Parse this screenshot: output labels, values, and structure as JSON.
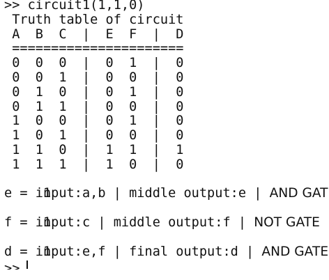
{
  "console": {
    "command": ">> circuit1(1,1,0)",
    "title": " Truth table of circuit",
    "header": " A  B  C  |  E  F  |  D",
    "separator": " ======================",
    "rows": [
      " 0  0  0  |  0  1  |  0",
      " 0  0  1  |  0  0  |  0",
      " 0  1  0  |  0  1  |  0",
      " 0  1  1  |  0  0  |  0",
      " 1  0  0  |  0  1  |  0",
      " 1  0  1  |  0  0  |  0",
      " 1  1  0  |  1  1  |  1",
      " 1  1  1  |  1  0  |  0"
    ],
    "gate1": {
      "label_a": "input:a,b | middle output:e | ",
      "label_b": "AND GATE",
      "result": "e =  1"
    },
    "gate2": {
      "label_a": "input:c | middle output:f | ",
      "label_b": "NOT GATE",
      "result": "f =  1"
    },
    "gate3": {
      "label_a": "input:e,f | final output:d | ",
      "label_b": "AND GATE",
      "result": "d =  1"
    },
    "prompt_partial": ">>"
  }
}
